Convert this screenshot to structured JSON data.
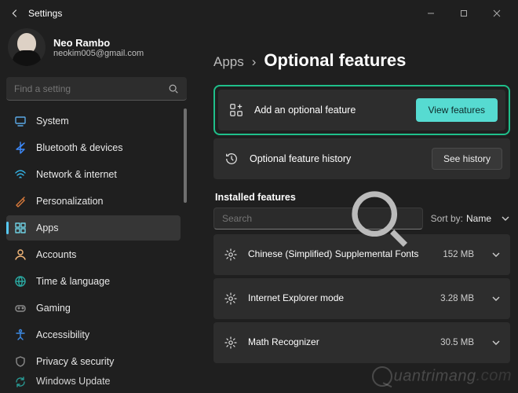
{
  "window": {
    "title": "Settings",
    "minimize": "—",
    "maximize": "▢",
    "close": "✕"
  },
  "profile": {
    "name": "Neo Rambo",
    "email": "neokim005@gmail.com"
  },
  "search": {
    "placeholder": "Find a setting"
  },
  "sidebar": {
    "items": [
      {
        "icon": "system-icon",
        "label": "System",
        "color": "#5aa9e6"
      },
      {
        "icon": "bluetooth-icon",
        "label": "Bluetooth & devices",
        "color": "#3d8bff"
      },
      {
        "icon": "wifi-icon",
        "label": "Network & internet",
        "color": "#34b1e3"
      },
      {
        "icon": "brush-icon",
        "label": "Personalization",
        "color": "#d97a3b"
      },
      {
        "icon": "apps-icon",
        "label": "Apps",
        "color": "#6fd1e3",
        "active": true
      },
      {
        "icon": "user-icon",
        "label": "Accounts",
        "color": "#f4b87a"
      },
      {
        "icon": "globe-icon",
        "label": "Time & language",
        "color": "#2aa8a1"
      },
      {
        "icon": "gaming-icon",
        "label": "Gaming",
        "color": "#8c8c8c"
      },
      {
        "icon": "accessibility-icon",
        "label": "Accessibility",
        "color": "#3d8be6"
      },
      {
        "icon": "shield-icon",
        "label": "Privacy & security",
        "color": "#8c8c8c"
      },
      {
        "icon": "update-icon",
        "label": "Windows Update",
        "color": "#2aa8a1",
        "cutoff": true
      }
    ]
  },
  "breadcrumb": {
    "parent": "Apps",
    "sep": "›",
    "current": "Optional features"
  },
  "cards": {
    "add": {
      "label": "Add an optional feature",
      "button": "View features"
    },
    "history": {
      "label": "Optional feature history",
      "button": "See history"
    }
  },
  "installed": {
    "title": "Installed features",
    "search_placeholder": "Search",
    "sort_prefix": "Sort by:",
    "sort_value": "Name",
    "items": [
      {
        "name": "Chinese (Simplified) Supplemental Fonts",
        "size": "152 MB"
      },
      {
        "name": "Internet Explorer mode",
        "size": "3.28 MB"
      },
      {
        "name": "Math Recognizer",
        "size": "30.5 MB"
      }
    ]
  },
  "watermark": "uantrimang"
}
